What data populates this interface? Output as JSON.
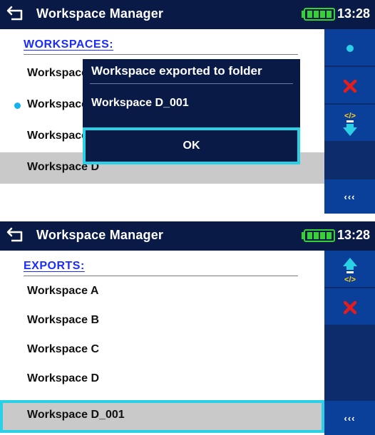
{
  "screen1": {
    "title": "Workspace Manager",
    "time": "13:28",
    "section": "WORKSPACES:",
    "items": [
      {
        "label": "Workspace A"
      },
      {
        "label": "Workspace B"
      },
      {
        "label": "Workspace C"
      },
      {
        "label": "Workspace D"
      }
    ],
    "dialog": {
      "title": "Workspace exported to folder",
      "message": "Workspace D_001",
      "ok": "OK"
    },
    "sidebar": {
      "buttons": [
        "open-dot-icon",
        "delete-x-icon",
        "export-down-icon"
      ],
      "more": "‹‹‹"
    }
  },
  "screen2": {
    "title": "Workspace Manager",
    "time": "13:28",
    "section": "EXPORTS:",
    "items": [
      {
        "label": "Workspace A"
      },
      {
        "label": "Workspace B"
      },
      {
        "label": "Workspace C"
      },
      {
        "label": "Workspace D"
      },
      {
        "label": "Workspace D_001"
      }
    ],
    "sidebar": {
      "buttons": [
        "import-up-icon",
        "delete-x-icon"
      ],
      "more": "‹‹‹"
    }
  },
  "colors": {
    "header": "#0a1a46",
    "sidebar_button": "#0a3f9a",
    "sidebar_bg": "#0d2c6b",
    "section_header": "#1a2cff",
    "highlight": "#2ad0e6",
    "selected_row": "#c9c9c9",
    "battery": "#35d135",
    "delete_icon": "#e31c1c"
  }
}
